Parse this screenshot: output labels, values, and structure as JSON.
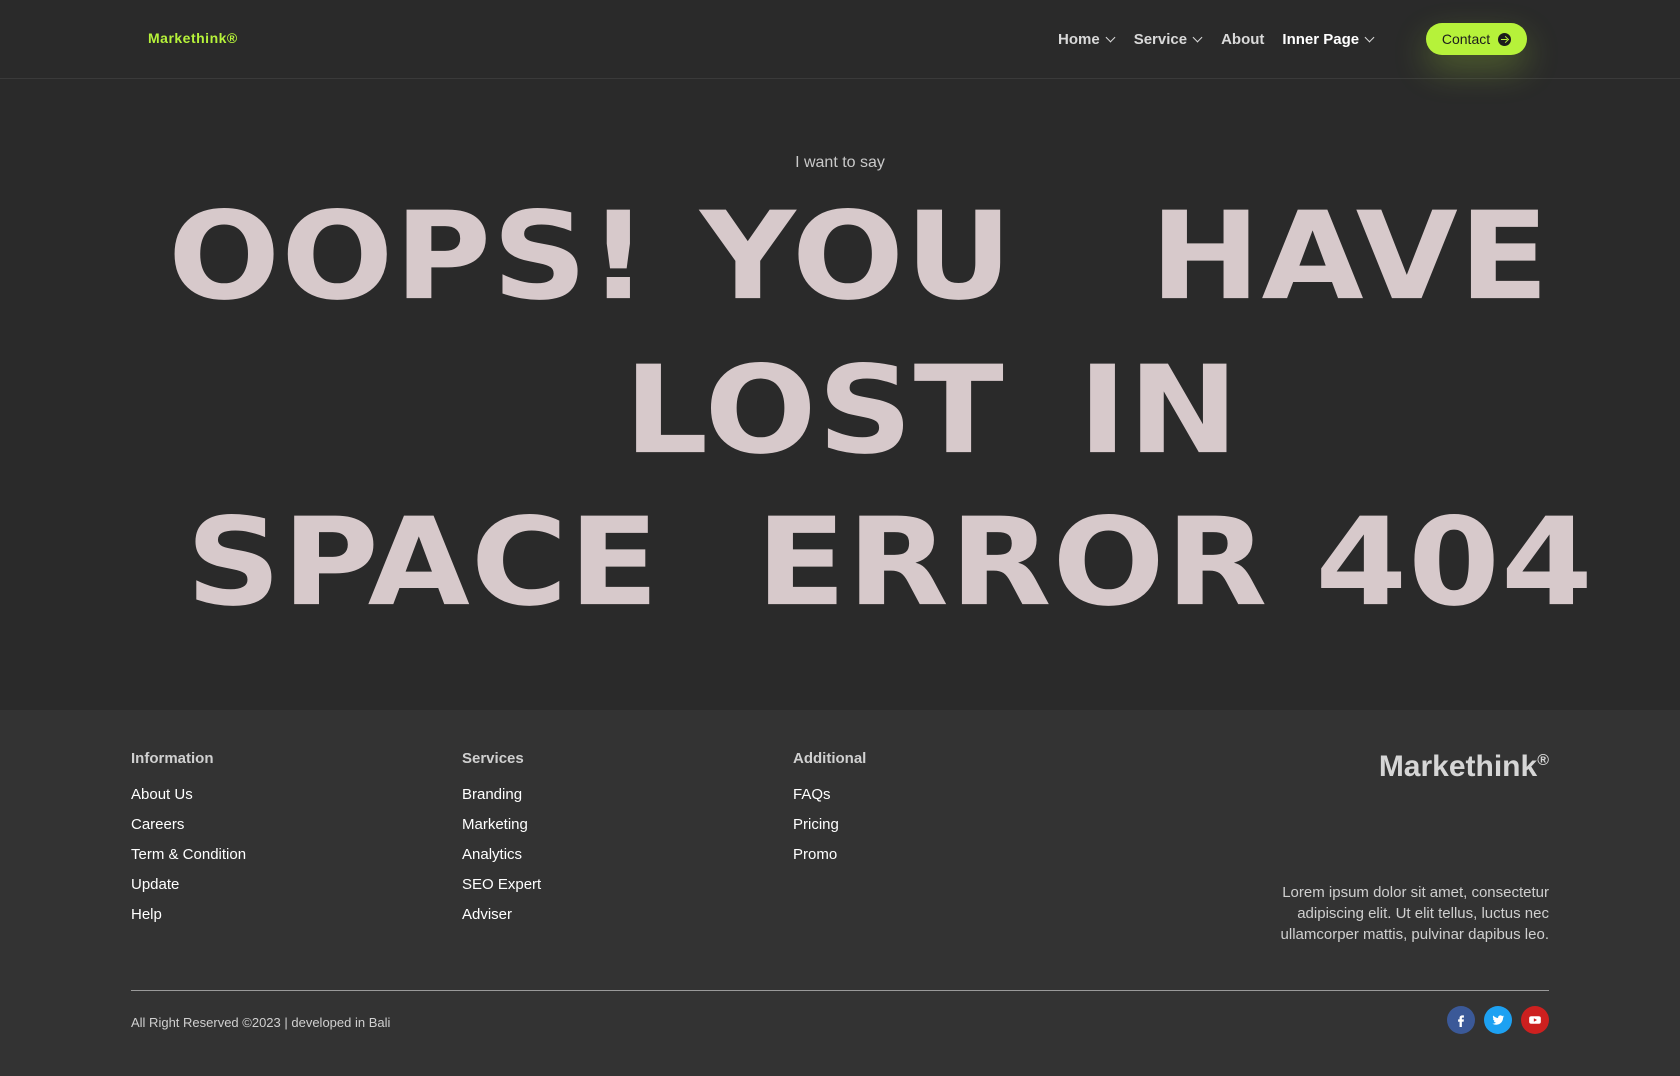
{
  "header": {
    "brand": "Markethink®",
    "nav": [
      {
        "label": "Home",
        "dropdown": true
      },
      {
        "label": "Service",
        "dropdown": true
      },
      {
        "label": "About",
        "dropdown": false
      },
      {
        "label": "Inner Page",
        "dropdown": true
      }
    ],
    "contact_label": "Contact"
  },
  "hero": {
    "kicker": "I want to say",
    "line1": [
      "OOPS!",
      "YOU",
      "HAVE"
    ],
    "line2": [
      "LOST",
      "IN"
    ],
    "line3": [
      "SPACE",
      "ERROR 404"
    ]
  },
  "footer": {
    "columns": [
      {
        "title": "Information",
        "links": [
          "About Us",
          "Careers",
          "Term & Condition",
          "Update",
          "Help"
        ]
      },
      {
        "title": "Services",
        "links": [
          "Branding",
          "Marketing",
          "Analytics",
          "SEO Expert",
          "Adviser"
        ]
      },
      {
        "title": "Additional",
        "links": [
          "FAQs",
          "Pricing",
          "Promo"
        ]
      }
    ],
    "brand": "Markethink",
    "brand_mark": "®",
    "description": "Lorem ipsum dolor sit amet, consectetur adipiscing elit. Ut elit tellus, luctus nec ullamcorper mattis, pulvinar dapibus leo.",
    "copyright": "All Right Reserved ©2023 | developed in Bali",
    "socials": [
      {
        "icon": "facebook-icon",
        "color": "#3b5998"
      },
      {
        "icon": "twitter-icon",
        "color": "#1da1f2"
      },
      {
        "icon": "youtube-icon",
        "color": "#cd201f"
      }
    ]
  },
  "colors": {
    "accent": "#b6f23a",
    "hero_text": "#d7c9cb",
    "bg": "#2a2a2a",
    "footer_bg": "#333333"
  }
}
